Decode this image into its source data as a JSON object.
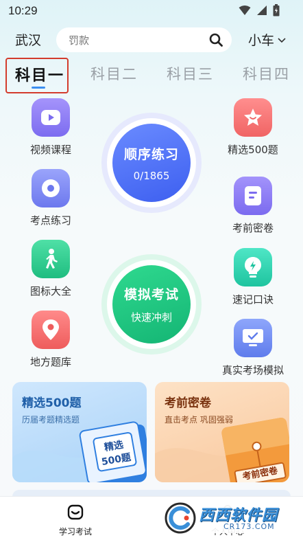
{
  "status_bar": {
    "time": "10:29"
  },
  "header": {
    "city": "武汉",
    "search_placeholder": "罚款",
    "vehicle": "小车"
  },
  "tabs": [
    {
      "label": "科目一",
      "active": true
    },
    {
      "label": "科目二",
      "active": false
    },
    {
      "label": "科目三",
      "active": false
    },
    {
      "label": "科目四",
      "active": false
    }
  ],
  "left_features": [
    {
      "label": "视频课程",
      "icon": "play-icon",
      "color": "#8b7cf6"
    },
    {
      "label": "考点练习",
      "icon": "target-icon",
      "color": "#7a86f2"
    },
    {
      "label": "图标大全",
      "icon": "walking-person-icon",
      "color": "#2ccb8f"
    },
    {
      "label": "地方题库",
      "icon": "location-pin-icon",
      "color": "#f26b6b"
    }
  ],
  "right_features": [
    {
      "label": "精选500题",
      "icon": "star-icon",
      "color": "#f27373"
    },
    {
      "label": "考前密卷",
      "icon": "document-icon",
      "color": "#8b7cf6"
    },
    {
      "label": "速记口诀",
      "icon": "lightbulb-icon",
      "color": "#2ecfb0"
    },
    {
      "label": "真实考场模拟",
      "icon": "monitor-icon",
      "color": "#6f8cf0"
    }
  ],
  "sequential_practice": {
    "title": "顺序练习",
    "progress": "0/1865",
    "done": 0,
    "total": 1865
  },
  "mock_exam": {
    "title": "模拟考试",
    "subtitle": "快速冲刺"
  },
  "cards": [
    {
      "title": "精选500题",
      "subtitle": "历届考题精选题",
      "tag_line1": "精选",
      "tag_line2": "500题",
      "bg": "#bfe0fb",
      "title_color": "#1f5fa8"
    },
    {
      "title": "考前密卷",
      "subtitle": "直击考点 巩固强弱",
      "envelope_label": "考前密卷",
      "bg": "#fcd8b6",
      "title_color": "#8a3b12"
    }
  ],
  "bottom_nav": [
    {
      "label": "学习考试",
      "icon": "study-icon",
      "active": true
    },
    {
      "label": "个人中心",
      "icon": "user-icon",
      "active": false
    }
  ],
  "watermark": {
    "logo_text": "西西软件园",
    "url_text": "CR173.COM"
  }
}
